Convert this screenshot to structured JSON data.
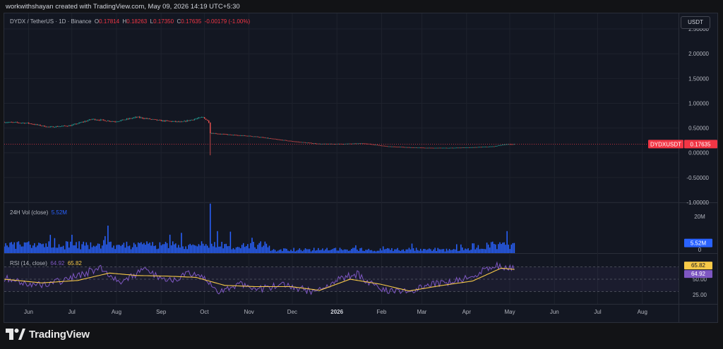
{
  "header": {
    "credit": "workwithshayan created with TradingView.com, May 09, 2026 14:19 UTC+5:30"
  },
  "legend": {
    "symbol": "DYDX / TetherUS · 1D · Binance",
    "o_label": "O",
    "o_value": "0.17814",
    "h_label": "H",
    "h_value": "0.18263",
    "l_label": "L",
    "l_value": "0.17350",
    "c_label": "C",
    "c_value": "0.17635",
    "change": "-0.00179 (-1.00%)"
  },
  "currency_button": "USDT",
  "volume_pane": {
    "title": "24H Vol (close)",
    "value": "5.52M",
    "axis": [
      "20M",
      "0"
    ]
  },
  "rsi_pane": {
    "title": "RSI (14, close)",
    "rsi_value": "64.92",
    "ma_value": "65.82",
    "axis": [
      "50.00",
      "25.00"
    ]
  },
  "price_axis_labels": [
    "2.50000",
    "2.00000",
    "1.50000",
    "1.00000",
    "0.50000",
    "0.00000",
    "-0.50000",
    "-1.00000"
  ],
  "price_tag": {
    "symbol": "DYDXUSDT",
    "value": "0.17635"
  },
  "x_axis_labels": [
    "Jun",
    "Jul",
    "Aug",
    "Sep",
    "Oct",
    "Nov",
    "Dec",
    "2026",
    "Feb",
    "Mar",
    "Apr",
    "May",
    "Jun",
    "Jul",
    "Aug"
  ],
  "brand": "TradingView",
  "colors": {
    "up": "#26a69a",
    "down": "#ef5350",
    "volume": "#2962ff",
    "rsi": "#7e57c2",
    "rsi_ma": "#f7c948",
    "price_tag": "#f23645"
  },
  "chart_data": [
    {
      "type": "candlestick",
      "title": "DYDX / TetherUS · 1D · Binance",
      "x_range": [
        "2025-05-20",
        "2026-05-09"
      ],
      "ylim": [
        -1.0,
        2.7
      ],
      "close_points": [
        {
          "date": "2025-05-20",
          "value": 0.62
        },
        {
          "date": "2025-06-05",
          "value": 0.6
        },
        {
          "date": "2025-06-20",
          "value": 0.52
        },
        {
          "date": "2025-07-05",
          "value": 0.55
        },
        {
          "date": "2025-07-20",
          "value": 0.68
        },
        {
          "date": "2025-08-05",
          "value": 0.63
        },
        {
          "date": "2025-08-20",
          "value": 0.72
        },
        {
          "date": "2025-09-05",
          "value": 0.65
        },
        {
          "date": "2025-09-20",
          "value": 0.62
        },
        {
          "date": "2025-10-05",
          "value": 0.72
        },
        {
          "date": "2025-10-09",
          "value": 0.62
        },
        {
          "date": "2025-10-10",
          "value": 0.4
        },
        {
          "date": "2025-10-25",
          "value": 0.36
        },
        {
          "date": "2025-11-10",
          "value": 0.33
        },
        {
          "date": "2025-11-25",
          "value": 0.27
        },
        {
          "date": "2025-12-10",
          "value": 0.22
        },
        {
          "date": "2025-12-25",
          "value": 0.18
        },
        {
          "date": "2026-01-10",
          "value": 0.18
        },
        {
          "date": "2026-01-25",
          "value": 0.19
        },
        {
          "date": "2026-02-10",
          "value": 0.13
        },
        {
          "date": "2026-02-25",
          "value": 0.11
        },
        {
          "date": "2026-03-10",
          "value": 0.1
        },
        {
          "date": "2026-03-25",
          "value": 0.1
        },
        {
          "date": "2026-04-10",
          "value": 0.11
        },
        {
          "date": "2026-04-25",
          "value": 0.13
        },
        {
          "date": "2026-05-02",
          "value": 0.17
        },
        {
          "date": "2026-05-09",
          "value": 0.17635
        }
      ],
      "last_close": 0.17635
    },
    {
      "type": "bar",
      "title": "24H Vol (close)",
      "unit": "USDT",
      "ylim": [
        0,
        20000000
      ],
      "spikes": [
        {
          "date": "2025-07-31",
          "value": 15000000
        },
        {
          "date": "2025-10-10",
          "value": 27000000
        },
        {
          "date": "2025-10-15",
          "value": 12000000
        },
        {
          "date": "2026-05-04",
          "value": 12000000
        }
      ],
      "last_value": 5520000
    },
    {
      "type": "line",
      "title": "RSI (14, close)",
      "ylim": [
        10,
        90
      ],
      "series": [
        {
          "name": "RSI",
          "points": [
            {
              "date": "2025-05-20",
              "value": 52
            },
            {
              "date": "2025-06-10",
              "value": 40
            },
            {
              "date": "2025-07-01",
              "value": 48
            },
            {
              "date": "2025-07-25",
              "value": 68
            },
            {
              "date": "2025-08-10",
              "value": 45
            },
            {
              "date": "2025-08-25",
              "value": 65
            },
            {
              "date": "2025-09-10",
              "value": 48
            },
            {
              "date": "2025-09-25",
              "value": 58
            },
            {
              "date": "2025-10-05",
              "value": 52
            },
            {
              "date": "2025-10-15",
              "value": 30
            },
            {
              "date": "2025-11-01",
              "value": 42
            },
            {
              "date": "2025-11-15",
              "value": 35
            },
            {
              "date": "2025-12-01",
              "value": 40
            },
            {
              "date": "2025-12-20",
              "value": 30
            },
            {
              "date": "2026-01-10",
              "value": 52
            },
            {
              "date": "2026-01-20",
              "value": 58
            },
            {
              "date": "2026-02-05",
              "value": 35
            },
            {
              "date": "2026-02-20",
              "value": 28
            },
            {
              "date": "2026-03-10",
              "value": 40
            },
            {
              "date": "2026-03-25",
              "value": 45
            },
            {
              "date": "2026-04-10",
              "value": 55
            },
            {
              "date": "2026-04-25",
              "value": 72
            },
            {
              "date": "2026-05-05",
              "value": 70
            },
            {
              "date": "2026-05-09",
              "value": 64.92
            }
          ]
        },
        {
          "name": "RSI-based MA",
          "points": [
            {
              "date": "2025-05-20",
              "value": 50
            },
            {
              "date": "2025-06-15",
              "value": 44
            },
            {
              "date": "2025-07-10",
              "value": 48
            },
            {
              "date": "2025-08-01",
              "value": 60
            },
            {
              "date": "2025-08-20",
              "value": 56
            },
            {
              "date": "2025-09-10",
              "value": 55
            },
            {
              "date": "2025-09-30",
              "value": 53
            },
            {
              "date": "2025-10-20",
              "value": 40
            },
            {
              "date": "2025-11-10",
              "value": 38
            },
            {
              "date": "2025-12-05",
              "value": 38
            },
            {
              "date": "2025-12-25",
              "value": 32
            },
            {
              "date": "2026-01-15",
              "value": 50
            },
            {
              "date": "2026-02-05",
              "value": 42
            },
            {
              "date": "2026-02-25",
              "value": 31
            },
            {
              "date": "2026-03-20",
              "value": 40
            },
            {
              "date": "2026-04-10",
              "value": 47
            },
            {
              "date": "2026-04-30",
              "value": 68
            },
            {
              "date": "2026-05-09",
              "value": 65.82
            }
          ]
        }
      ],
      "band": [
        30,
        70
      ],
      "midline": 50
    }
  ]
}
